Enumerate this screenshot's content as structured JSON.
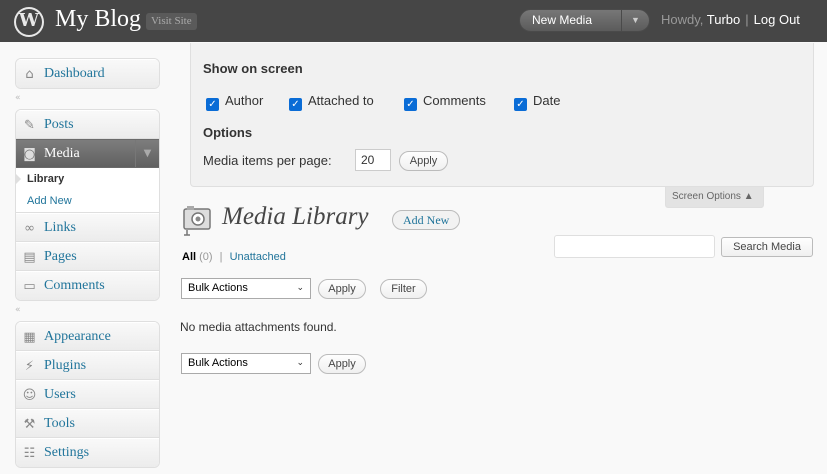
{
  "header": {
    "logo_glyph": "W",
    "site_title": "My Blog",
    "visit_site": "Visit Site",
    "favorite_action": "New Media",
    "howdy": "Howdy,",
    "user_name": "Turbo",
    "log_out": "Log Out"
  },
  "sidebar": {
    "dashboard": {
      "label": "Dashboard",
      "icon": "home-icon"
    },
    "posts": {
      "label": "Posts",
      "icon": "pushpin-icon"
    },
    "media": {
      "label": "Media",
      "icon": "camera-icon"
    },
    "media_submenu": [
      {
        "label": "Library",
        "current": true
      },
      {
        "label": "Add New",
        "current": false
      }
    ],
    "links": {
      "label": "Links",
      "icon": "link-icon"
    },
    "pages": {
      "label": "Pages",
      "icon": "page-icon"
    },
    "comments": {
      "label": "Comments",
      "icon": "speech-bubble-icon"
    },
    "appearance": {
      "label": "Appearance",
      "icon": "appearance-icon"
    },
    "plugins": {
      "label": "Plugins",
      "icon": "plug-icon"
    },
    "users": {
      "label": "Users",
      "icon": "users-icon"
    },
    "tools": {
      "label": "Tools",
      "icon": "tools-icon"
    },
    "settings": {
      "label": "Settings",
      "icon": "settings-icon"
    }
  },
  "screen_options": {
    "show_on_screen": "Show on screen",
    "columns": [
      {
        "label": "Author",
        "checked": true
      },
      {
        "label": "Attached to",
        "checked": true
      },
      {
        "label": "Comments",
        "checked": true
      },
      {
        "label": "Date",
        "checked": true
      }
    ],
    "options_heading": "Options",
    "per_page_label": "Media items per page:",
    "per_page_value": "20",
    "apply": "Apply",
    "tab_label": "Screen Options ▲"
  },
  "main": {
    "title": "Media Library",
    "add_new": "Add New",
    "filters": {
      "all": "All",
      "all_count": "(0)",
      "separator": "|",
      "unattached": "Unattached"
    },
    "search_button": "Search Media",
    "bulk_actions_top": "Bulk Actions",
    "apply_top": "Apply",
    "filter": "Filter",
    "empty_message": "No media attachments found.",
    "bulk_actions_bottom": "Bulk Actions",
    "apply_bottom": "Apply"
  },
  "colors": {
    "header_bg": "#464646",
    "link": "#21759b",
    "active_menu": "#6d6d6d",
    "checkbox": "#0a6cd6"
  }
}
